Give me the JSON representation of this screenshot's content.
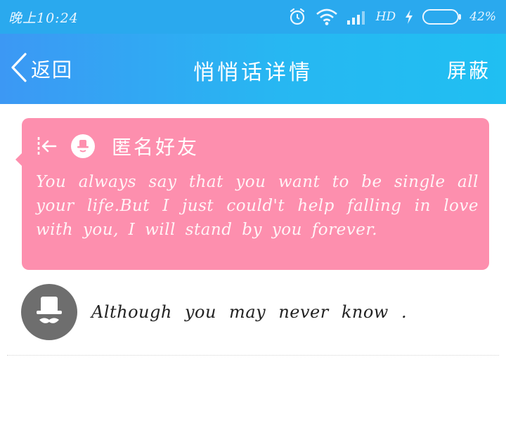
{
  "status_bar": {
    "time": "晚上10:24",
    "network": "HD",
    "battery_percent": "42%",
    "battery_level": 0.42,
    "icons": [
      "alarm-icon",
      "wifi-icon",
      "signal-icon",
      "charging-icon",
      "battery-icon"
    ]
  },
  "nav": {
    "back_label": "返回",
    "title": "悄悄话详情",
    "block_label": "屏蔽"
  },
  "message_card": {
    "sender": "匿名好友",
    "text": "You always say  that you want to be single all your life.But I just could't help falling in love with you, I will stand by you forever.",
    "background_color": "#fd8fae"
  },
  "reply": {
    "text": "Although you may never know ."
  },
  "colors": {
    "status_bar": "#2aa9ee",
    "nav_start": "#3c98f4",
    "nav_end": "#20bff2",
    "battery_fill": "#6cd53d"
  }
}
